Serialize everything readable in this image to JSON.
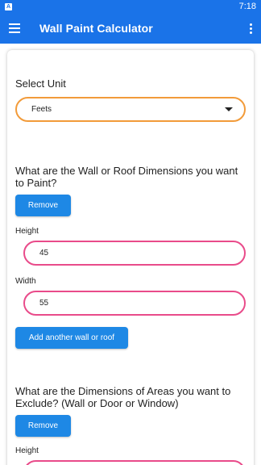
{
  "status_bar": {
    "notification_glyph": "A",
    "time": "7:18"
  },
  "app_bar": {
    "title": "Wall Paint Calculator",
    "menu_icon": "hamburger-menu-icon",
    "overflow_icon": "more-vert-icon"
  },
  "unit": {
    "label": "Select Unit",
    "selected": "Feets"
  },
  "walls": {
    "heading": "What are the Wall or Roof Dimensions you want to Paint?",
    "remove_label": "Remove",
    "height_label": "Height",
    "height_value": "45",
    "width_label": "Width",
    "width_value": "55",
    "add_label": "Add another wall or roof"
  },
  "exclude": {
    "heading": "What are the Dimensions of Areas you want to Exclude? (Wall or Door or Window)",
    "remove_label": "Remove",
    "height_label": "Height"
  },
  "colors": {
    "primary": "#1a73e8",
    "button": "#1e88e5",
    "select_border": "#f29b3a",
    "field_border": "#e94b8a"
  }
}
